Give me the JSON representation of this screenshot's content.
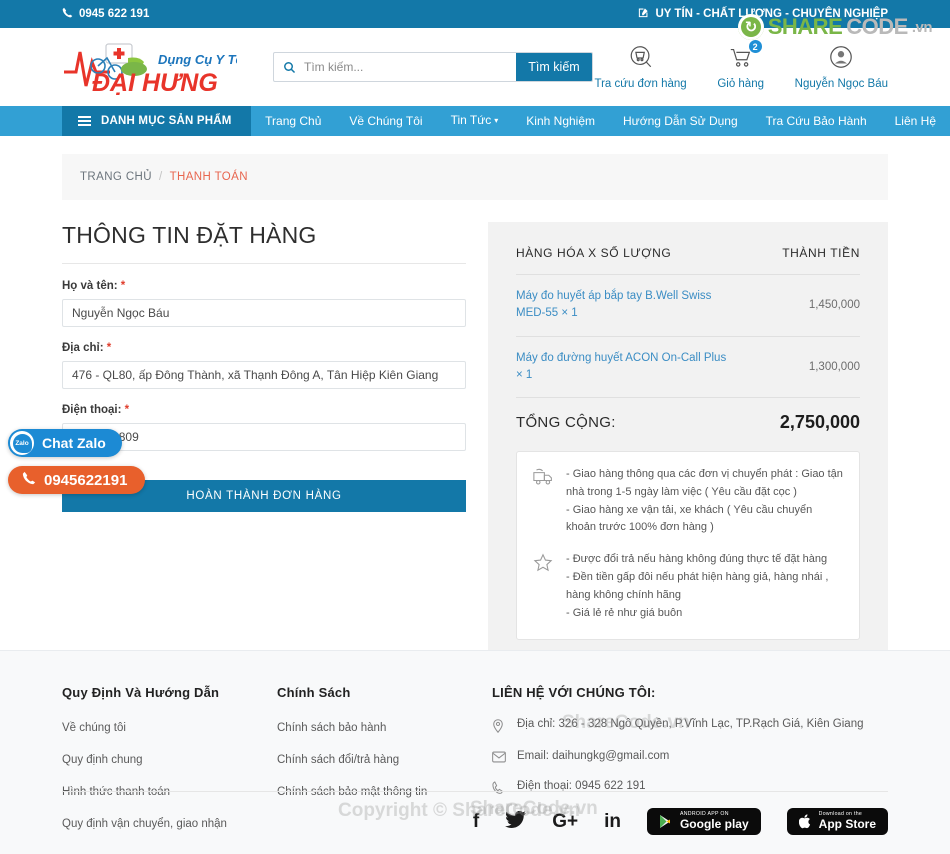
{
  "topbar": {
    "phone": "0945 622 191",
    "phone_icon": "phone-icon",
    "slogan": "UY TÍN - CHẤT LƯỢNG - CHUYÊN NGHIỆP",
    "slogan_icon": "pencil-square-icon"
  },
  "watermark": {
    "badge": "↻",
    "share": "SHARE",
    "code": "CODE",
    "vn": ".vn",
    "mid": "ShareCode.vn",
    "copyright": "Copyright © ShareCode.vn",
    "lower": "ShareCode.vn"
  },
  "brand": {
    "tagline": "Dụng Cụ Y Tế",
    "name": "ĐẠI HƯNG"
  },
  "search": {
    "placeholder": "Tìm kiếm...",
    "value": "",
    "button": "Tìm kiếm",
    "icon": "search-icon"
  },
  "header_actions": [
    {
      "label": "Tra cứu đơn hàng",
      "icon": "order-lookup-icon",
      "badge": ""
    },
    {
      "label": "Giỏ hàng",
      "icon": "shopping-cart-icon",
      "badge": "2"
    },
    {
      "label": "Nguyễn Ngọc Báu",
      "icon": "user-account-icon",
      "badge": ""
    }
  ],
  "nav": {
    "category_label": "DANH MỤC SẢN PHẨM",
    "category_icon": "hamburger-icon",
    "links": [
      {
        "label": "Trang Chủ",
        "caret": false
      },
      {
        "label": "Về Chúng Tôi",
        "caret": false
      },
      {
        "label": "Tin Tức",
        "caret": true
      },
      {
        "label": "Kinh Nghiệm",
        "caret": false
      },
      {
        "label": "Hướng Dẫn Sử Dụng",
        "caret": false
      },
      {
        "label": "Tra Cứu Bảo Hành",
        "caret": false
      },
      {
        "label": "Liên Hệ",
        "caret": false
      }
    ]
  },
  "breadcrumb": {
    "home": "TRANG CHỦ",
    "separator": "/",
    "current": "THANH TOÁN"
  },
  "form": {
    "title": "THÔNG TIN ĐẶT HÀNG",
    "required_mark": "*",
    "fields": [
      {
        "label": "Họ và tên:",
        "value": "Nguyễn Ngọc Báu",
        "placeholder": "Họ và tên",
        "name": "fullname-field"
      },
      {
        "label": "Địa chỉ:",
        "value": "476 - QL80, ấp Đông Thành, xã Thạnh Đông A, Tân Hiệp Kiên Giang",
        "placeholder": "Địa chỉ",
        "name": "address-field"
      },
      {
        "label": "Điện thoại:",
        "value": "0985883809",
        "placeholder": "Điện thoại",
        "name": "phone-field"
      }
    ],
    "submit": "HOÀN THÀNH ĐƠN HÀNG"
  },
  "summary": {
    "col_product": "HÀNG HÓA X SỐ LƯỢNG",
    "col_amount": "THÀNH TIỀN",
    "items": [
      {
        "name": "Máy đo huyết áp bắp tay B.Well Swiss MED-55 × 1",
        "amount": "1,450,000"
      },
      {
        "name": "Máy đo đường huyết ACON On-Call Plus × 1",
        "amount": "1,300,000"
      }
    ],
    "total_label": "TỔNG CỘNG:",
    "total_value": "2,750,000",
    "policies": [
      {
        "icon": "delivery-truck-icon",
        "lines": [
          "- Giao hàng thông qua các đơn vị chuyển phát : Giao tận nhà trong 1-5 ngày làm việc ( Yêu cầu đặt cọc )",
          "- Giao hàng xe vận tải, xe khách ( Yêu cầu chuyển khoản trước 100% đơn hàng )"
        ]
      },
      {
        "icon": "star-icon",
        "lines": [
          "- Được đổi trả nếu hàng không đúng thực tế đặt hàng",
          "- Đền tiền gấp đôi nếu phát hiện hàng giả, hàng nhái , hàng không chính hãng",
          "- Giá lẻ rẻ như giá buôn"
        ]
      }
    ]
  },
  "footer": {
    "columns": [
      {
        "title": "Quy Định Và Hướng Dẫn",
        "links": [
          "Về chúng tôi",
          "Quy định chung",
          "Hình thức thanh toán",
          "Quy định vận chuyển, giao nhận"
        ]
      },
      {
        "title": "Chính Sách",
        "links": [
          "Chính sách bảo hành",
          "Chính sách đổi/trả hàng",
          "Chính sách bảo mật thông tin"
        ]
      }
    ],
    "contact": {
      "title": "LIÊN HỆ VỚI CHÚNG TÔI:",
      "lines": [
        {
          "icon": "map-pin-icon",
          "text": "Địa chỉ: 326 - 328 Ngô Quyền, P.Vĩnh Lạc, TP.Rạch Giá, Kiên Giang"
        },
        {
          "icon": "envelope-icon",
          "text": "Email: daihungkg@gmail.com"
        },
        {
          "icon": "phone-icon",
          "text": "Điện thoại: 0945 622 191"
        }
      ]
    },
    "socials": [
      {
        "icon": "facebook-icon",
        "glyph": "f"
      },
      {
        "icon": "twitter-icon",
        "glyph": "🐦"
      },
      {
        "icon": "google-plus-icon",
        "glyph": "G+"
      },
      {
        "icon": "linkedin-icon",
        "glyph": "in"
      }
    ],
    "stores": [
      {
        "icon": "google-play-icon",
        "small": "ANDROID APP ON",
        "big": "Google play"
      },
      {
        "icon": "apple-app-store-icon",
        "small": "Download on the",
        "big": "App Store"
      }
    ]
  },
  "floating": {
    "zalo_label": "Chat Zalo",
    "zalo_icon": "zalo-icon",
    "zalo_mark": "Zalo",
    "phone_label": "0945622191",
    "phone_icon": "phone-icon"
  },
  "colors": {
    "topbar": "#1378a8",
    "nav": "#32a0d4",
    "nav_cat": "#1378a8",
    "accent_link": "#3b8dc4",
    "crumb_current": "#e8664f",
    "required": "#e03e2d",
    "zalo": "#1c8ad4",
    "phone_float": "#e8602c"
  }
}
